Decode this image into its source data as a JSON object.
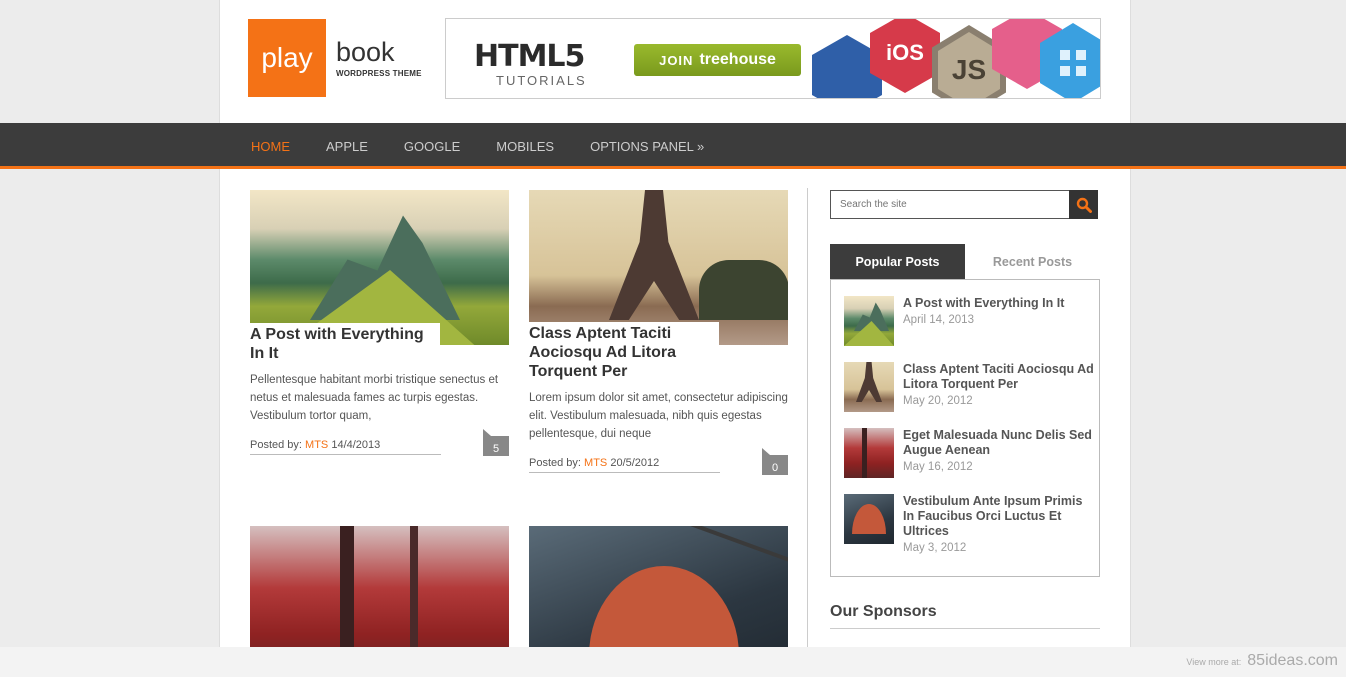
{
  "logo": {
    "play": "play",
    "book": "book",
    "subtitle": "WORDPRESS THEME",
    "accent": "#f47216"
  },
  "banner": {
    "title": "HTML5",
    "subtitle": "TUTORIALS",
    "join_prefix": "JOIN",
    "join_brand": "treehouse",
    "badge_ios": "iOS",
    "badge_js": "JS"
  },
  "nav": {
    "items": [
      "HOME",
      "APPLE",
      "GOOGLE",
      "MOBILES",
      "OPTIONS PANEL »"
    ],
    "active": "HOME"
  },
  "posts": [
    {
      "title": "A Post with Everything In It",
      "excerpt": "Pellentesque habitant morbi tristique senectus et netus et malesuada fames ac turpis egestas. Vestibulum tortor quam,",
      "posted_by_label": "Posted by:",
      "author": "MTS",
      "date": "14/4/2013",
      "comments": "5"
    },
    {
      "title": "Class Aptent Taciti Aociosqu Ad Litora Torquent Per",
      "excerpt": "Lorem ipsum dolor sit amet, consectetur adipiscing elit. Vestibulum malesuada, nibh quis egestas pellentesque, dui neque",
      "posted_by_label": "Posted by:",
      "author": "MTS",
      "date": "20/5/2012",
      "comments": "0"
    }
  ],
  "sidebar": {
    "search_placeholder": "Search the site",
    "tabs": [
      "Popular Posts",
      "Recent Posts"
    ],
    "popular": [
      {
        "title": "A Post with Everything In It",
        "date": "April 14, 2013"
      },
      {
        "title": "Class Aptent Taciti Aociosqu Ad Litora Torquent Per",
        "date": "May 20, 2012"
      },
      {
        "title": "Eget Malesuada Nunc Delis Sed Augue Aenean",
        "date": "May 16, 2012"
      },
      {
        "title": "Vestibulum Ante Ipsum Primis In Faucibus Orci Luctus Et Ultrices",
        "date": "May 3, 2012"
      }
    ],
    "sponsors_heading": "Our Sponsors"
  },
  "footer": {
    "view_more": "View more at:",
    "site": "85ideas.com"
  }
}
